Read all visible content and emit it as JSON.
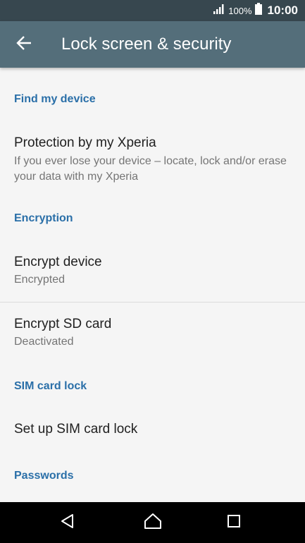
{
  "status_bar": {
    "battery_text": "100%",
    "time": "10:00",
    "icons": [
      "signal-icon",
      "battery-icon"
    ]
  },
  "app_bar": {
    "title": "Lock screen & security",
    "back_icon": "arrow-back-icon"
  },
  "sections": {
    "find_my_device": {
      "header": "Find my device",
      "protection": {
        "title": "Protection by my Xperia",
        "summary": "If you ever lose your device – locate, lock and/or erase your data with my Xperia"
      }
    },
    "encryption": {
      "header": "Encryption",
      "encrypt_device": {
        "title": "Encrypt device",
        "summary": "Encrypted"
      },
      "encrypt_sd": {
        "title": "Encrypt SD card",
        "summary": "Deactivated"
      }
    },
    "sim_card_lock": {
      "header": "SIM card lock",
      "setup": {
        "title": "Set up SIM card lock"
      }
    },
    "passwords": {
      "header": "Passwords"
    }
  },
  "nav_bar": {
    "icons": [
      "back-triangle-icon",
      "home-icon",
      "recents-icon"
    ]
  },
  "colors": {
    "status_bar": "#37474f",
    "app_bar": "#546e7a",
    "section_header": "#2a6fa8",
    "background": "#f5f5f5"
  }
}
